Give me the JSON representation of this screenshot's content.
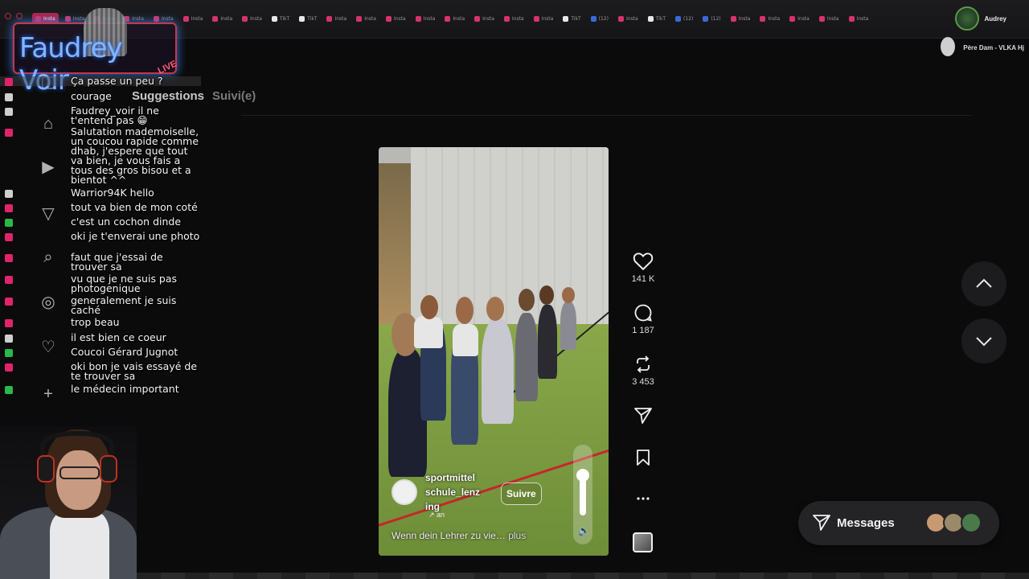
{
  "browser": {
    "tabs": [
      "Insta",
      "Insta",
      "Insta",
      "Insta",
      "Insta",
      "Insta",
      "Insta",
      "Insta",
      "TikT",
      "TikT",
      "Insta",
      "Insta",
      "Insta",
      "Insta",
      "Insta",
      "Insta",
      "Insta",
      "Insta",
      "TikT",
      "(12)",
      "Insta",
      "TikT",
      "(12)",
      "(12)",
      "Insta",
      "Insta",
      "Insta",
      "Insta",
      "Insta"
    ],
    "profile_name": "Audrey",
    "now_playing": "Père Dam - VLKA Hj"
  },
  "overlay": {
    "logo_text": "Faudrey Voir",
    "logo_badge": "LIVE"
  },
  "chat": [
    {
      "text": "Ça passe un peu ?",
      "badge_color": "#e0246a"
    },
    {
      "text": "courage",
      "badge_color": "#cfcfcf"
    },
    {
      "text": "Faudrey_voir il ne t'entend pas 😁",
      "badge_color": "#cfcfcf"
    },
    {
      "text": "Salutation mademoiselle, un coucou rapide comme dhab, j'espere que tout va bien, je vous fais a tous des gros bisou et a bientot ^^",
      "badge_color": "#e0246a"
    },
    {
      "text": "Warrior94K hello",
      "badge_color": "#cfcfcf"
    },
    {
      "text": "tout va bien de mon coté",
      "badge_color": "#e0246a"
    },
    {
      "text": "c'est un cochon dinde",
      "badge_color": "#2ab84a"
    },
    {
      "text": "oki je t'enverai une photo",
      "badge_color": "#e0246a"
    },
    {
      "text": "faut que j'essai de trouver sa",
      "badge_color": "#e0246a"
    },
    {
      "text": "vu que je ne suis pas photogenique",
      "badge_color": "#e0246a"
    },
    {
      "text": "generalement je suis caché",
      "badge_color": "#e0246a"
    },
    {
      "text": "trop beau",
      "badge_color": "#e0246a"
    },
    {
      "text": "il est bien ce coeur",
      "badge_color": "#cfcfcf"
    },
    {
      "text": "Coucoi Gérard Jugnot",
      "badge_color": "#2ab84a"
    },
    {
      "text": "oki bon je vais essayé de te trouver sa",
      "badge_color": "#e0246a"
    },
    {
      "text": "le médecin important",
      "badge_color": "#2ab84a"
    }
  ],
  "feed_tabs": {
    "suggestions": "Suggestions",
    "following": "Suivi(e)"
  },
  "reel": {
    "author": "sportmittel schule_lenz ing",
    "follow_label": "Suivre",
    "sub": "↗ an",
    "caption": "Wenn dein Lehrer zu vie…",
    "more": "plus"
  },
  "actions": {
    "likes": "141 K",
    "comments": "1 187",
    "reposts": "3 453"
  },
  "messages": {
    "label": "Messages"
  },
  "colors": {
    "accent": "#c8364a",
    "panel": "#242426"
  }
}
